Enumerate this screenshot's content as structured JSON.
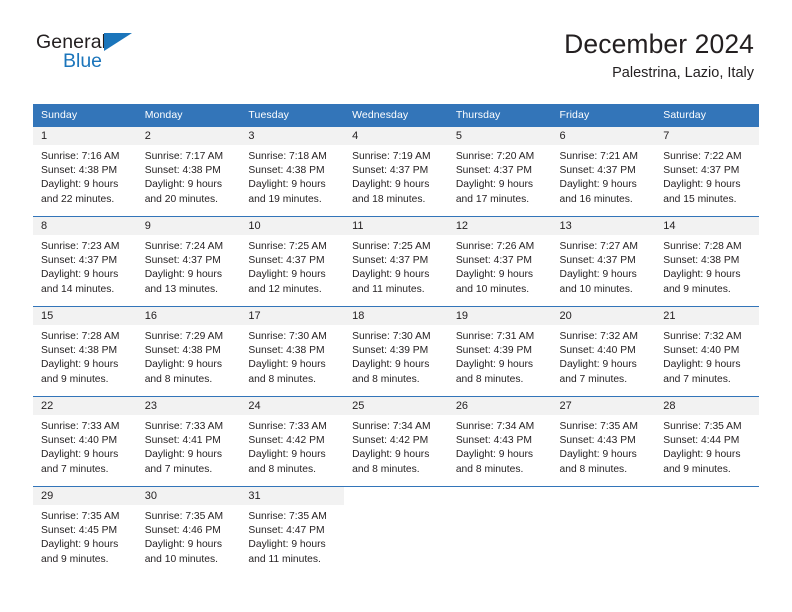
{
  "brand": {
    "name_part1": "General",
    "name_part2": "Blue",
    "triangle_color": "#1b75bb"
  },
  "header": {
    "title": "December 2024",
    "subtitle": "Palestrina, Lazio, Italy"
  },
  "colors": {
    "header_blue": "#3375b9",
    "daynum_bg": "#f2f2f2",
    "text": "#231f20"
  },
  "weekdays": [
    "Sunday",
    "Monday",
    "Tuesday",
    "Wednesday",
    "Thursday",
    "Friday",
    "Saturday"
  ],
  "weeks": [
    [
      {
        "day": "1",
        "sunrise": "Sunrise: 7:16 AM",
        "sunset": "Sunset: 4:38 PM",
        "daylight1": "Daylight: 9 hours",
        "daylight2": "and 22 minutes."
      },
      {
        "day": "2",
        "sunrise": "Sunrise: 7:17 AM",
        "sunset": "Sunset: 4:38 PM",
        "daylight1": "Daylight: 9 hours",
        "daylight2": "and 20 minutes."
      },
      {
        "day": "3",
        "sunrise": "Sunrise: 7:18 AM",
        "sunset": "Sunset: 4:38 PM",
        "daylight1": "Daylight: 9 hours",
        "daylight2": "and 19 minutes."
      },
      {
        "day": "4",
        "sunrise": "Sunrise: 7:19 AM",
        "sunset": "Sunset: 4:37 PM",
        "daylight1": "Daylight: 9 hours",
        "daylight2": "and 18 minutes."
      },
      {
        "day": "5",
        "sunrise": "Sunrise: 7:20 AM",
        "sunset": "Sunset: 4:37 PM",
        "daylight1": "Daylight: 9 hours",
        "daylight2": "and 17 minutes."
      },
      {
        "day": "6",
        "sunrise": "Sunrise: 7:21 AM",
        "sunset": "Sunset: 4:37 PM",
        "daylight1": "Daylight: 9 hours",
        "daylight2": "and 16 minutes."
      },
      {
        "day": "7",
        "sunrise": "Sunrise: 7:22 AM",
        "sunset": "Sunset: 4:37 PM",
        "daylight1": "Daylight: 9 hours",
        "daylight2": "and 15 minutes."
      }
    ],
    [
      {
        "day": "8",
        "sunrise": "Sunrise: 7:23 AM",
        "sunset": "Sunset: 4:37 PM",
        "daylight1": "Daylight: 9 hours",
        "daylight2": "and 14 minutes."
      },
      {
        "day": "9",
        "sunrise": "Sunrise: 7:24 AM",
        "sunset": "Sunset: 4:37 PM",
        "daylight1": "Daylight: 9 hours",
        "daylight2": "and 13 minutes."
      },
      {
        "day": "10",
        "sunrise": "Sunrise: 7:25 AM",
        "sunset": "Sunset: 4:37 PM",
        "daylight1": "Daylight: 9 hours",
        "daylight2": "and 12 minutes."
      },
      {
        "day": "11",
        "sunrise": "Sunrise: 7:25 AM",
        "sunset": "Sunset: 4:37 PM",
        "daylight1": "Daylight: 9 hours",
        "daylight2": "and 11 minutes."
      },
      {
        "day": "12",
        "sunrise": "Sunrise: 7:26 AM",
        "sunset": "Sunset: 4:37 PM",
        "daylight1": "Daylight: 9 hours",
        "daylight2": "and 10 minutes."
      },
      {
        "day": "13",
        "sunrise": "Sunrise: 7:27 AM",
        "sunset": "Sunset: 4:37 PM",
        "daylight1": "Daylight: 9 hours",
        "daylight2": "and 10 minutes."
      },
      {
        "day": "14",
        "sunrise": "Sunrise: 7:28 AM",
        "sunset": "Sunset: 4:38 PM",
        "daylight1": "Daylight: 9 hours",
        "daylight2": "and 9 minutes."
      }
    ],
    [
      {
        "day": "15",
        "sunrise": "Sunrise: 7:28 AM",
        "sunset": "Sunset: 4:38 PM",
        "daylight1": "Daylight: 9 hours",
        "daylight2": "and 9 minutes."
      },
      {
        "day": "16",
        "sunrise": "Sunrise: 7:29 AM",
        "sunset": "Sunset: 4:38 PM",
        "daylight1": "Daylight: 9 hours",
        "daylight2": "and 8 minutes."
      },
      {
        "day": "17",
        "sunrise": "Sunrise: 7:30 AM",
        "sunset": "Sunset: 4:38 PM",
        "daylight1": "Daylight: 9 hours",
        "daylight2": "and 8 minutes."
      },
      {
        "day": "18",
        "sunrise": "Sunrise: 7:30 AM",
        "sunset": "Sunset: 4:39 PM",
        "daylight1": "Daylight: 9 hours",
        "daylight2": "and 8 minutes."
      },
      {
        "day": "19",
        "sunrise": "Sunrise: 7:31 AM",
        "sunset": "Sunset: 4:39 PM",
        "daylight1": "Daylight: 9 hours",
        "daylight2": "and 8 minutes."
      },
      {
        "day": "20",
        "sunrise": "Sunrise: 7:32 AM",
        "sunset": "Sunset: 4:40 PM",
        "daylight1": "Daylight: 9 hours",
        "daylight2": "and 7 minutes."
      },
      {
        "day": "21",
        "sunrise": "Sunrise: 7:32 AM",
        "sunset": "Sunset: 4:40 PM",
        "daylight1": "Daylight: 9 hours",
        "daylight2": "and 7 minutes."
      }
    ],
    [
      {
        "day": "22",
        "sunrise": "Sunrise: 7:33 AM",
        "sunset": "Sunset: 4:40 PM",
        "daylight1": "Daylight: 9 hours",
        "daylight2": "and 7 minutes."
      },
      {
        "day": "23",
        "sunrise": "Sunrise: 7:33 AM",
        "sunset": "Sunset: 4:41 PM",
        "daylight1": "Daylight: 9 hours",
        "daylight2": "and 7 minutes."
      },
      {
        "day": "24",
        "sunrise": "Sunrise: 7:33 AM",
        "sunset": "Sunset: 4:42 PM",
        "daylight1": "Daylight: 9 hours",
        "daylight2": "and 8 minutes."
      },
      {
        "day": "25",
        "sunrise": "Sunrise: 7:34 AM",
        "sunset": "Sunset: 4:42 PM",
        "daylight1": "Daylight: 9 hours",
        "daylight2": "and 8 minutes."
      },
      {
        "day": "26",
        "sunrise": "Sunrise: 7:34 AM",
        "sunset": "Sunset: 4:43 PM",
        "daylight1": "Daylight: 9 hours",
        "daylight2": "and 8 minutes."
      },
      {
        "day": "27",
        "sunrise": "Sunrise: 7:35 AM",
        "sunset": "Sunset: 4:43 PM",
        "daylight1": "Daylight: 9 hours",
        "daylight2": "and 8 minutes."
      },
      {
        "day": "28",
        "sunrise": "Sunrise: 7:35 AM",
        "sunset": "Sunset: 4:44 PM",
        "daylight1": "Daylight: 9 hours",
        "daylight2": "and 9 minutes."
      }
    ],
    [
      {
        "day": "29",
        "sunrise": "Sunrise: 7:35 AM",
        "sunset": "Sunset: 4:45 PM",
        "daylight1": "Daylight: 9 hours",
        "daylight2": "and 9 minutes."
      },
      {
        "day": "30",
        "sunrise": "Sunrise: 7:35 AM",
        "sunset": "Sunset: 4:46 PM",
        "daylight1": "Daylight: 9 hours",
        "daylight2": "and 10 minutes."
      },
      {
        "day": "31",
        "sunrise": "Sunrise: 7:35 AM",
        "sunset": "Sunset: 4:47 PM",
        "daylight1": "Daylight: 9 hours",
        "daylight2": "and 11 minutes."
      },
      {
        "day": "",
        "sunrise": "",
        "sunset": "",
        "daylight1": "",
        "daylight2": ""
      },
      {
        "day": "",
        "sunrise": "",
        "sunset": "",
        "daylight1": "",
        "daylight2": ""
      },
      {
        "day": "",
        "sunrise": "",
        "sunset": "",
        "daylight1": "",
        "daylight2": ""
      },
      {
        "day": "",
        "sunrise": "",
        "sunset": "",
        "daylight1": "",
        "daylight2": ""
      }
    ]
  ]
}
